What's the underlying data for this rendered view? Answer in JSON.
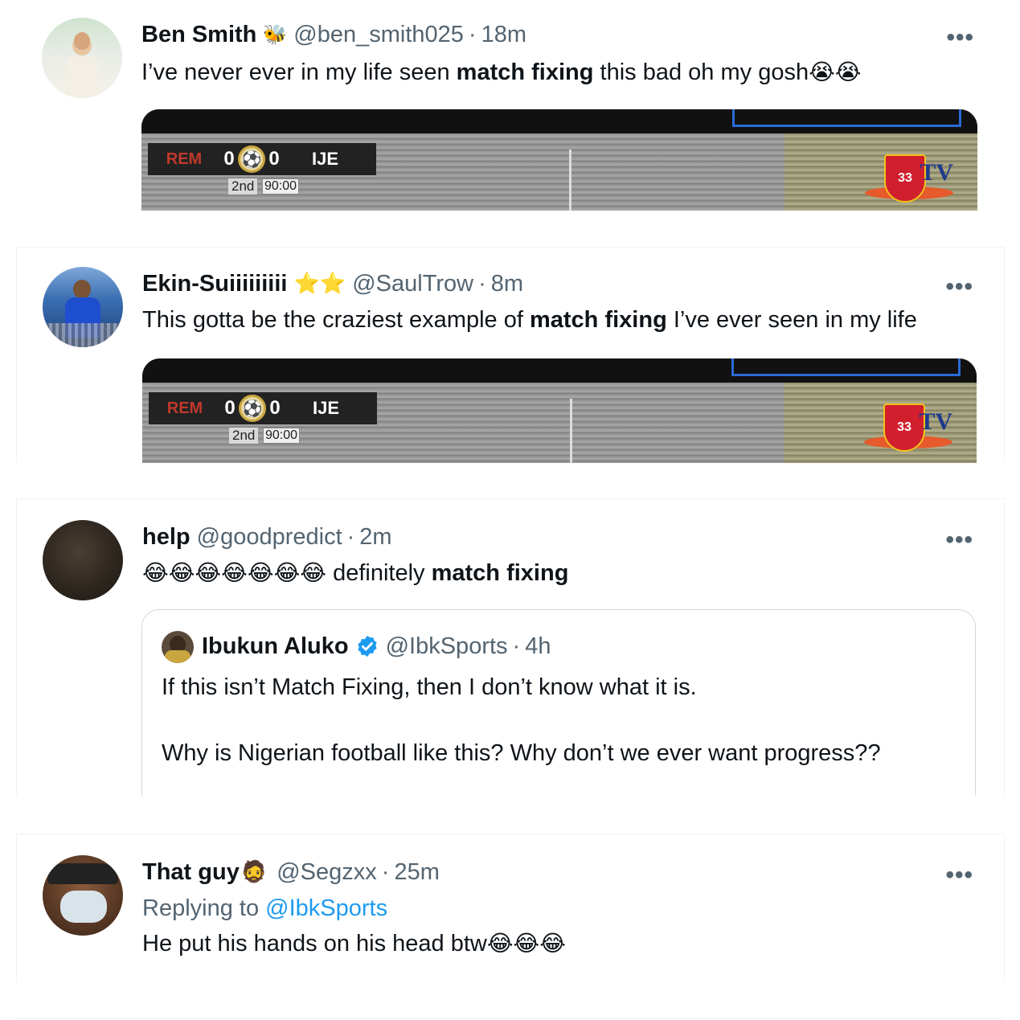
{
  "tweets": [
    {
      "name": "Ben Smith",
      "badge": "🐝",
      "handle": "@ben_smith025",
      "dot": "·",
      "time": "18m",
      "more": "•••",
      "text_pre": "I’ve never ever in my life seen ",
      "text_bold": "match fixing",
      "text_post": " this bad oh my gosh",
      "text_emoji": "😭😭"
    },
    {
      "name": "Ekin-Suiiiiiiiii",
      "badge": "⭐⭐",
      "handle": "@SaulTrow",
      "dot": "·",
      "time": "8m",
      "more": "•••",
      "text_pre": "This gotta be the craziest example of ",
      "text_bold": "match fixing",
      "text_post": " I’ve ever seen in my life"
    },
    {
      "name": "help",
      "handle": "@goodpredict",
      "dot": "·",
      "time": "2m",
      "more": "•••",
      "text_emoji": "😂😂😂😂😂😂😂",
      "text_pre": " definitely ",
      "text_bold": "match fixing",
      "quote": {
        "name": "Ibukun Aluko",
        "handle": "@IbkSports",
        "dot": "·",
        "time": "4h",
        "line1": "If this isn’t Match Fixing, then I don’t know what it is.",
        "line2": "Why is Nigerian football like this? Why don’t we ever want progress??"
      }
    },
    {
      "name": "That guy",
      "badge": "🧔",
      "handle": "@Segzxx",
      "dot": "·",
      "time": "25m",
      "more": "•••",
      "replying_prefix": "Replying to ",
      "replying_handle": "@IbkSports",
      "text_pre": "He put his hands on his head btw",
      "text_emoji": "😂😂😂"
    }
  ],
  "media": {
    "team1": "REM",
    "score1": "0",
    "score2": "0",
    "team2": "IJE",
    "half": "2nd",
    "clock": "90:00",
    "channel_number": "33",
    "channel": "TV"
  },
  "colors": {
    "text": "#0f1419",
    "secondary": "#536471",
    "link": "#1d9bf0",
    "border": "#eff3f4",
    "verified": "#1d9bf0"
  }
}
